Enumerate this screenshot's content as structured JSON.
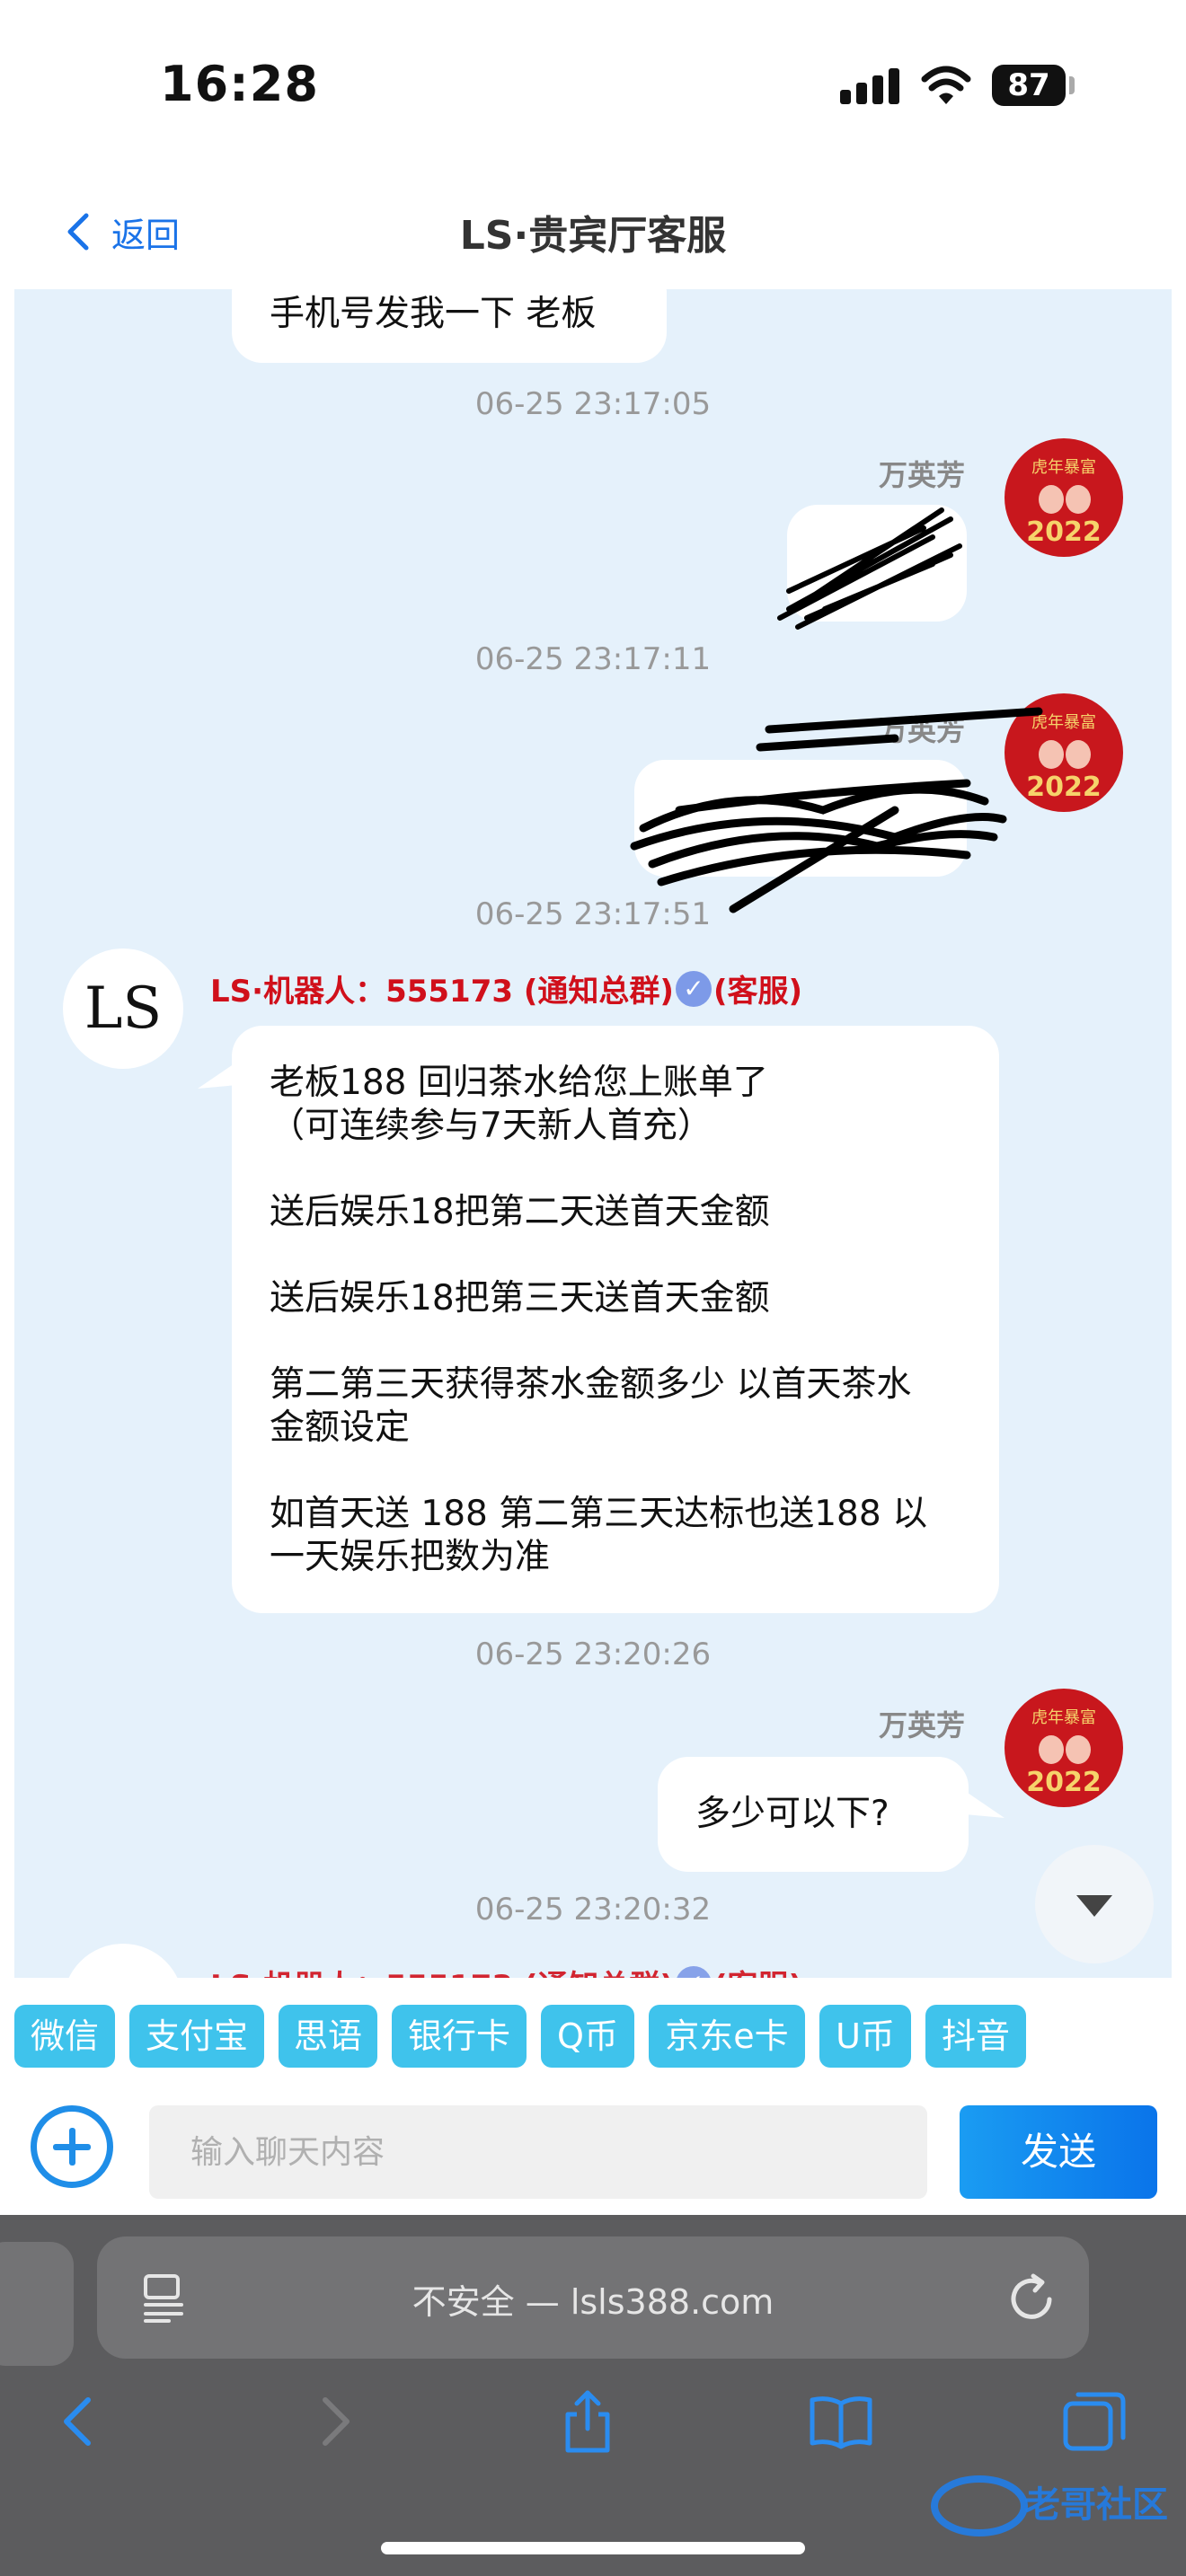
{
  "status_bar": {
    "time": "16:28",
    "battery": "87"
  },
  "header": {
    "back_label": "返回",
    "title": "LS·贵宾厅客服"
  },
  "messages": {
    "m1_text": "手机号发我一下 老板",
    "ts1": "06-25 23:17:05",
    "user_name_1": "万英芳",
    "ts2": "06-25 23:17:11",
    "user_name_2": "万英芳",
    "ts3": "06-25 23:17:51",
    "bot_name_prefix": "LS·机器人：555173 (通知总群)",
    "bot_name_suffix": "(客服)",
    "bot_lines": [
      "老板188 回归茶水给您上账单了",
      "（可连续参与7天新人首充）",
      "送后娱乐18把第二天送首天金额",
      "送后娱乐18把第三天送首天金额",
      "第二第三天获得茶水金额多少 以首天茶水",
      "金额设定",
      "如首天送 188 第二第三天达标也送188 以",
      "一天娱乐把数为准"
    ],
    "ts4": "06-25 23:20:26",
    "user_name_3": "万英芳",
    "m5_text": "多少可以下?",
    "ts5": "06-25 23:20:32",
    "avatar_text": "LS",
    "avatar_year": "2022"
  },
  "quick_chips": [
    "微信",
    "支付宝",
    "思语",
    "银行卡",
    "Q币",
    "京东e卡",
    "U币",
    "抖音"
  ],
  "input": {
    "placeholder": "输入聊天内容",
    "send_label": "发送"
  },
  "safari": {
    "address": "不安全 — lsls388.com"
  },
  "colors": {
    "accent": "#1f8ee8",
    "bot_name": "#d0101b",
    "chip": "#3fc3ec",
    "chat_bg": "#e5f1fb"
  },
  "icons": [
    "signal-icon",
    "wifi-icon",
    "battery-icon",
    "chevron-left-icon",
    "verified-icon",
    "chevron-down-icon",
    "plus-icon",
    "reader-icon",
    "reload-icon",
    "back-arrow-icon",
    "forward-arrow-icon",
    "share-icon",
    "bookmarks-icon",
    "tabs-icon"
  ]
}
